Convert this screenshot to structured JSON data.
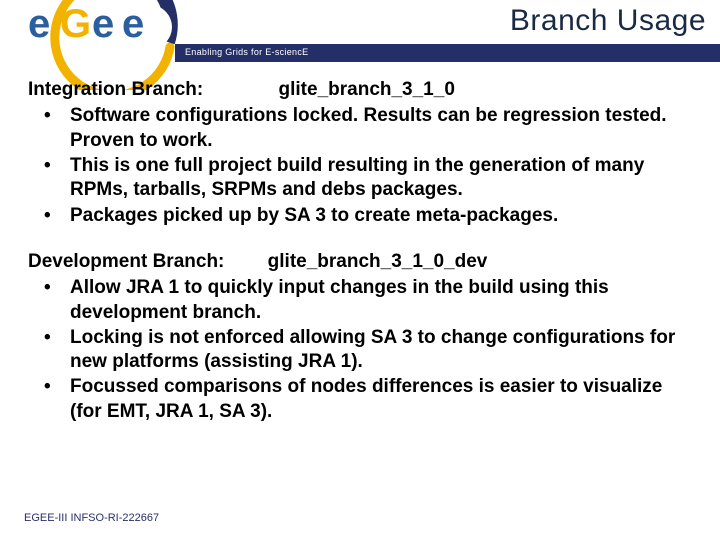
{
  "header": {
    "title": "Branch Usage",
    "tagline": "Enabling Grids for E-sciencE",
    "logo_letters": {
      "e1": "e",
      "g": "G",
      "e2": "e",
      "e3": "e"
    }
  },
  "section1": {
    "label": "Integration Branch:",
    "value": "glite_branch_3_1_0",
    "bullets": [
      "Software configurations locked. Results can be regression tested. Proven to work.",
      "This is one full project build resulting in the generation of many RPMs, tarballs, SRPMs and debs packages.",
      "Packages picked up by SA 3 to create meta-packages."
    ]
  },
  "section2": {
    "label": "Development Branch:",
    "value": "glite_branch_3_1_0_dev",
    "bullets": [
      "Allow JRA 1 to quickly input changes in the build using this development branch.",
      "Locking is not enforced allowing SA 3 to change configurations for new platforms (assisting JRA 1).",
      "Focussed comparisons of nodes differences is easier to visualize (for EMT, JRA 1, SA 3)."
    ]
  },
  "footer": {
    "text": "EGEE-III INFSO-RI-222667"
  }
}
